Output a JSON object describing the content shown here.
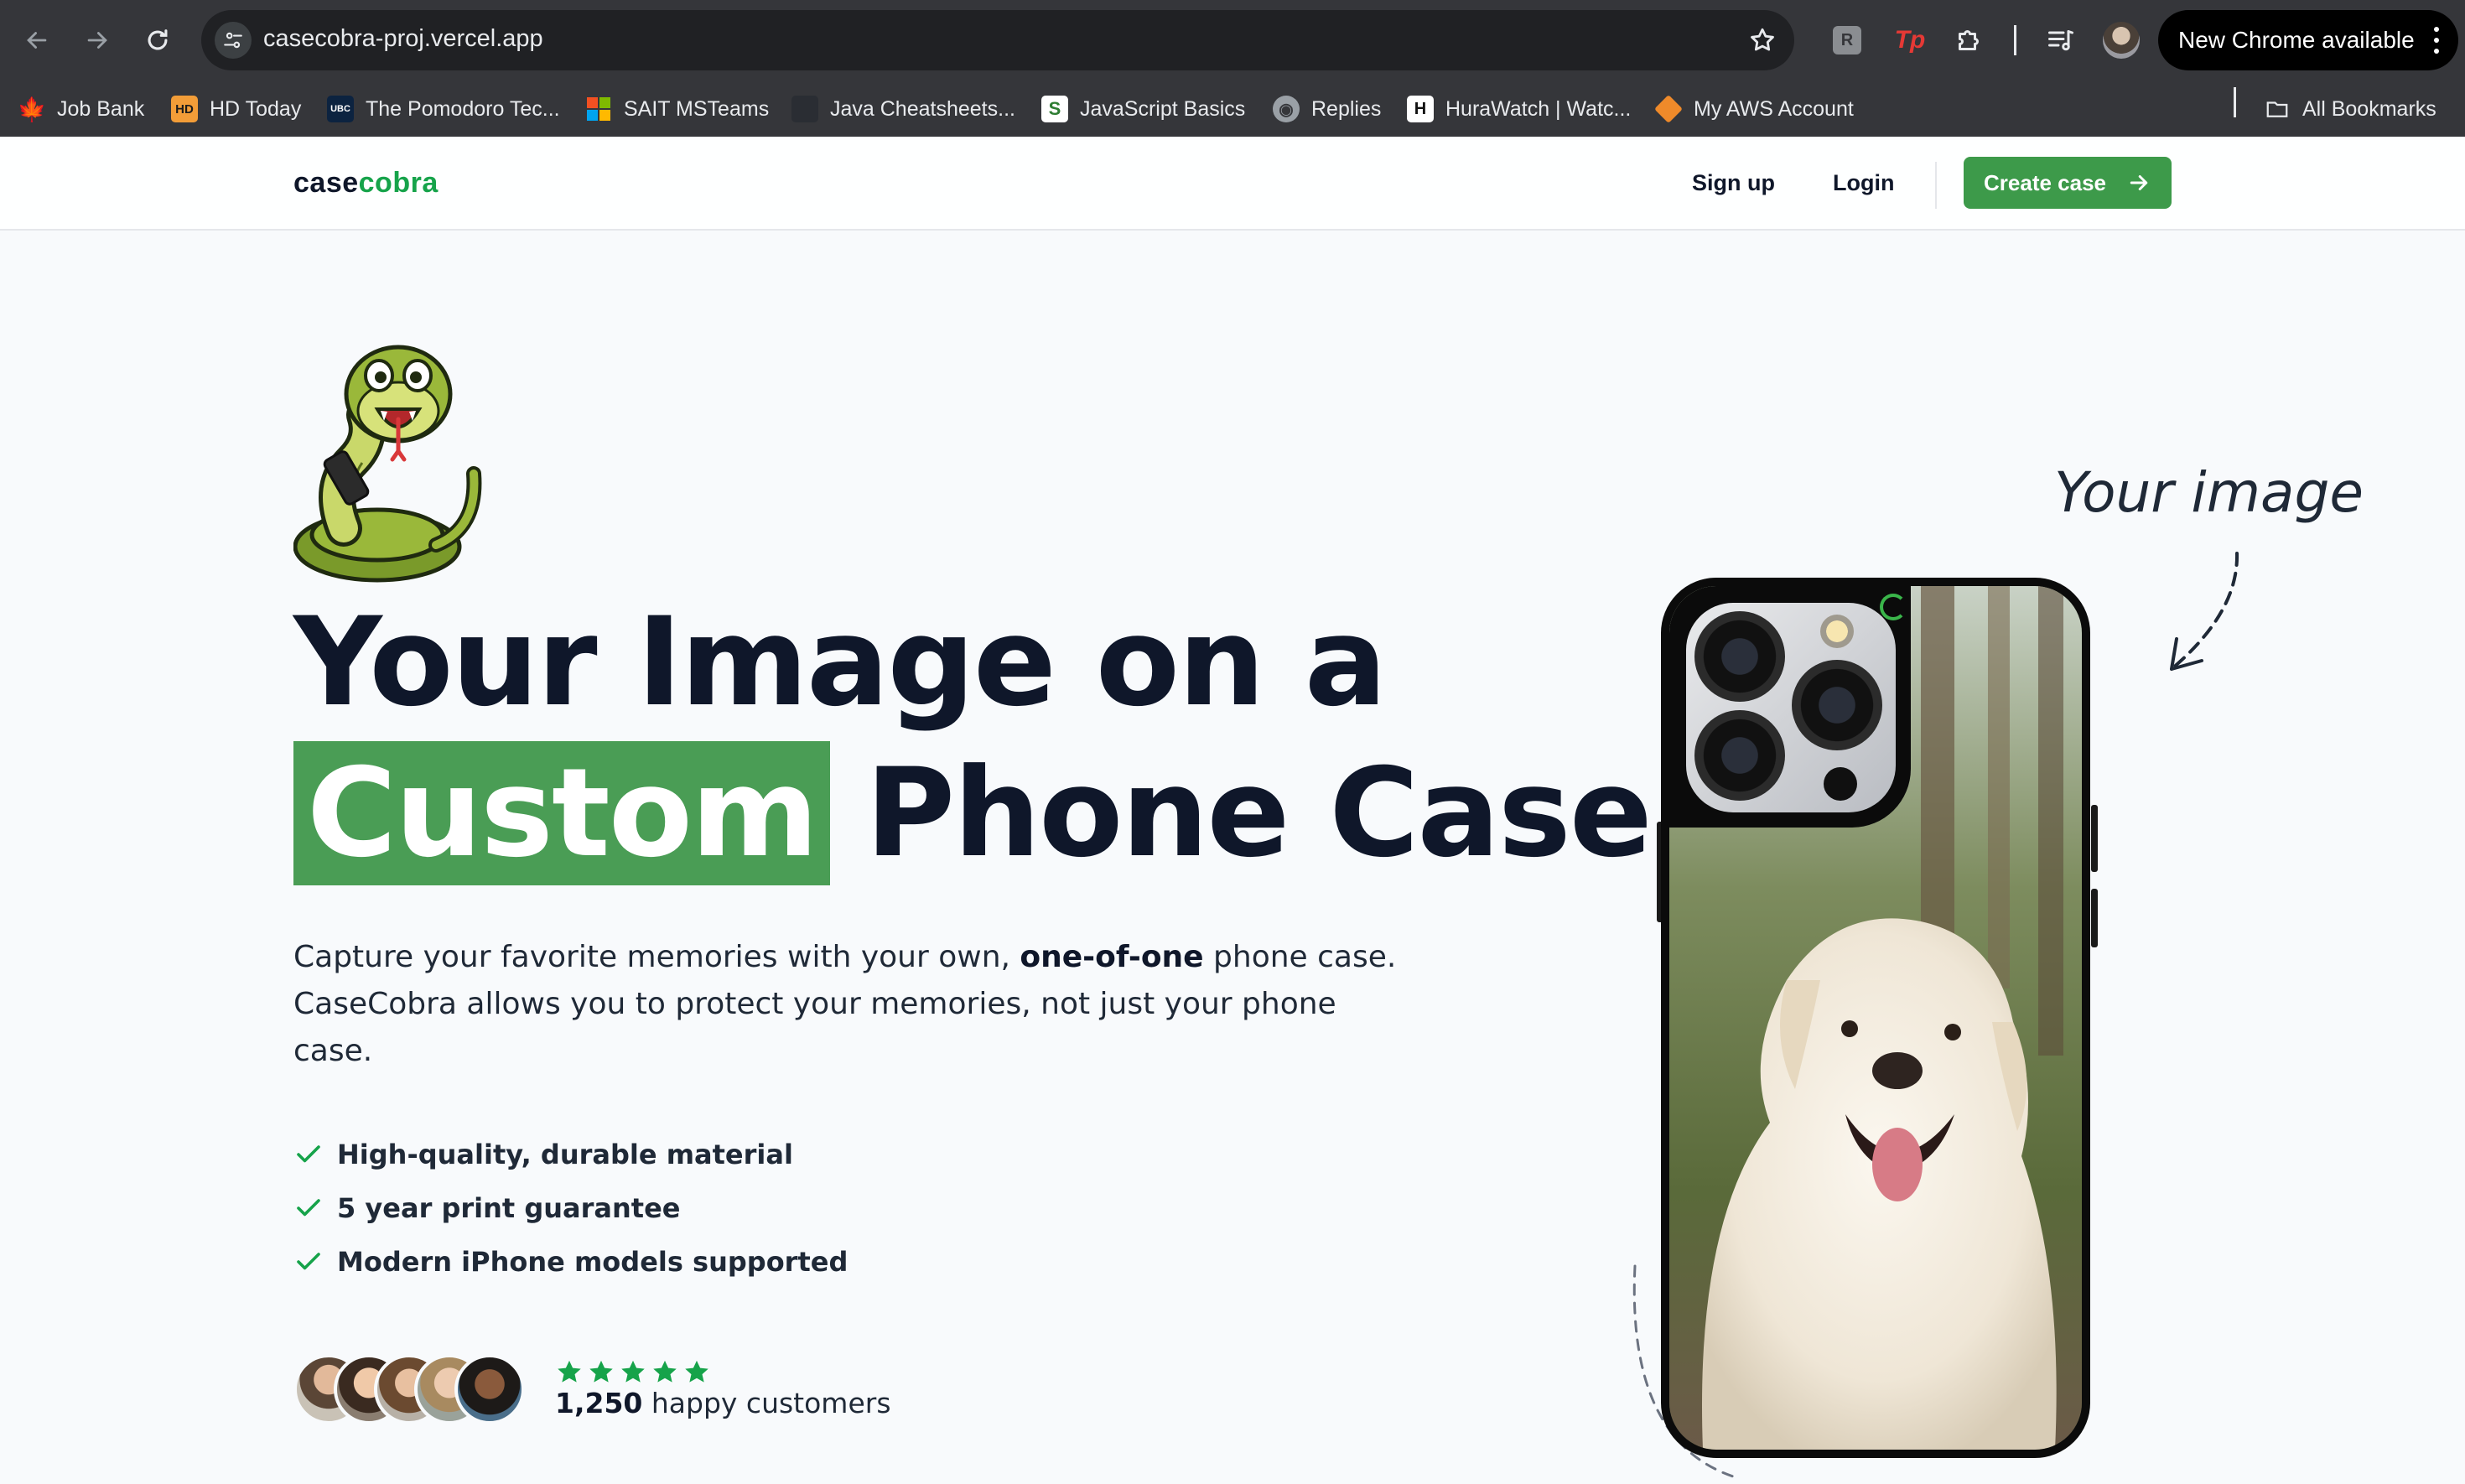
{
  "browser": {
    "url": "casecobra-proj.vercel.app",
    "update_label": "New Chrome available",
    "bookmarks": [
      {
        "label": "Job Bank",
        "icon": "maple-leaf-icon"
      },
      {
        "label": "HD Today",
        "icon": "hd-today-icon"
      },
      {
        "label": "The Pomodoro Tec...",
        "icon": "ubc-icon"
      },
      {
        "label": "SAIT MSTeams",
        "icon": "microsoft-icon"
      },
      {
        "label": "Java Cheatsheets...",
        "icon": "dark-square-icon"
      },
      {
        "label": "JavaScript Basics",
        "icon": "s-logo-icon"
      },
      {
        "label": "Replies",
        "icon": "globe-icon"
      },
      {
        "label": "HuraWatch | Watc...",
        "icon": "hurawatch-icon"
      },
      {
        "label": "My AWS Account",
        "icon": "aws-cube-icon"
      }
    ],
    "all_bookmarks_label": "All Bookmarks",
    "favicon_text": {
      "hd": "HD",
      "ubc": "UBC",
      "s": "S",
      "h": "H",
      "ext_r": "R",
      "ext_tp": "Tp"
    }
  },
  "nav": {
    "logo_part1": "case",
    "logo_part2": "cobra",
    "signup_label": "Sign up",
    "login_label": "Login",
    "cta_label": "Create case"
  },
  "hero": {
    "headline_line1": "Your Image on a",
    "headline_highlight": "Custom",
    "headline_rest": "Phone Case",
    "subtext_before": "Capture your favorite memories with your own, ",
    "subtext_bold": "one-of-one",
    "subtext_after": " phone case. CaseCobra allows you to protect your memories, not just your phone case.",
    "features": [
      "High-quality, durable material",
      "5 year print guarantee",
      "Modern iPhone models supported"
    ],
    "rating_stars": 5,
    "customers_count": "1,250",
    "customers_label": " happy customers",
    "annotation": "Your image"
  },
  "colors": {
    "brand_green": "#3d9a4a",
    "highlight_green": "#4a9d55",
    "text_dark": "#0f172a",
    "chrome_bg": "#35363a"
  }
}
